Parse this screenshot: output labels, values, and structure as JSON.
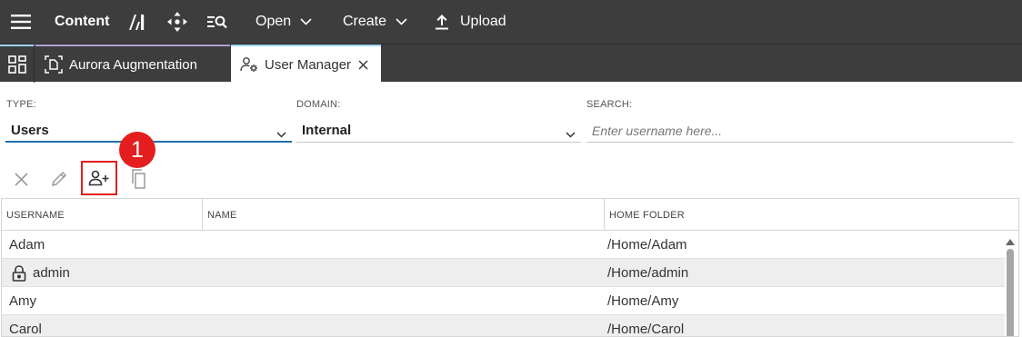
{
  "toolbar": {
    "menu_icon": "hamburger-icon",
    "title": "Content",
    "tools_icon": "pencil-ruler-icon",
    "move_icon": "move-arrows-icon",
    "search_icon": "list-search-icon",
    "open_label": "Open",
    "create_label": "Create",
    "upload_label": "Upload"
  },
  "tabs": {
    "home_icon": "dashboard-grid-icon",
    "items": [
      {
        "label": "Aurora Augmentation",
        "icon": "augmentation-doc-icon",
        "accent": "#b2a1d6"
      },
      {
        "label": "User Manager",
        "icon": "user-gear-icon",
        "accent": "#9fd3f1"
      }
    ]
  },
  "filters": {
    "type_label": "TYPE:",
    "type_value": "Users",
    "domain_label": "DOMAIN:",
    "domain_value": "Internal",
    "search_label": "SEARCH:",
    "search_placeholder": "Enter username here..."
  },
  "actions": {
    "delete_icon": "close-icon",
    "edit_icon": "pencil-icon",
    "add_user_icon": "add-user-icon",
    "copy_icon": "copy-icon",
    "callout_number": "1"
  },
  "grid": {
    "columns": [
      "USERNAME",
      "NAME",
      "HOME FOLDER"
    ],
    "rows": [
      {
        "username": "Adam",
        "name": "",
        "home": "/Home/Adam",
        "locked": false
      },
      {
        "username": "admin",
        "name": "",
        "home": "/Home/admin",
        "locked": true
      },
      {
        "username": "Amy",
        "name": "",
        "home": "/Home/Amy",
        "locked": false
      },
      {
        "username": "Carol",
        "name": "",
        "home": "/Home/Carol",
        "locked": false
      }
    ]
  },
  "colors": {
    "toolbar_bg": "#3d3d3d",
    "type_underline": "#1f6fa8",
    "highlight_red": "#e11f1f",
    "row_alt_bg": "#eeeeee"
  }
}
